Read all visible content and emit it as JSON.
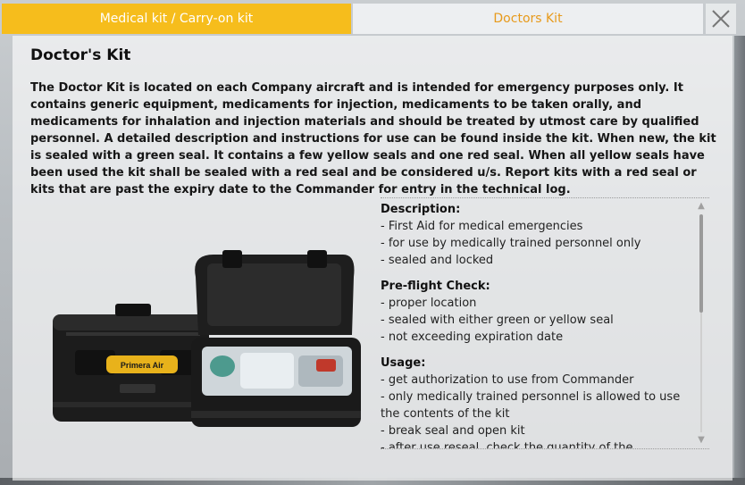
{
  "tabs": [
    {
      "label": "Medical kit / Carry-on kit"
    },
    {
      "label": "Doctors Kit"
    }
  ],
  "close_icon": "close-icon",
  "panel": {
    "title": "Doctor's Kit",
    "intro": "The Doctor Kit is located on each Company aircraft and is intended for emergency purposes only. It contains generic equipment, medicaments for injection, medicaments to be taken orally, and medicaments for inhalation and injection materials and should be treated by utmost care by qualified personnel. A detailed description and instructions for use can be found inside the kit. When new, the kit is sealed with a green seal. It contains a few yellow seals and one red seal. When all yellow seals have been used the kit shall be sealed with a red seal and be considered u/s. Report kits with a red seal or kits that are past the expiry date to the Commander for entry in the technical log.",
    "kit_brand": "Primera Air"
  },
  "details": {
    "description": {
      "heading": "Description:",
      "items": [
        "- First Aid for medical emergencies",
        "- for use by medically trained personnel only",
        "- sealed and locked"
      ]
    },
    "preflight": {
      "heading": "Pre-flight Check:",
      "items": [
        "- proper location",
        "- sealed with either green or yellow seal",
        "- not exceeding expiration date"
      ]
    },
    "usage": {
      "heading": "Usage:",
      "items": [
        "- get authorization to use from Commander",
        "- only medically trained personnel is allowed to use the contents of the kit",
        "- break seal and open kit",
        "- after use reseal, check the quantity of the medication"
      ]
    }
  },
  "colors": {
    "tab_active": "#f6bd1c",
    "tab_inactive_text": "#e79a1b"
  }
}
